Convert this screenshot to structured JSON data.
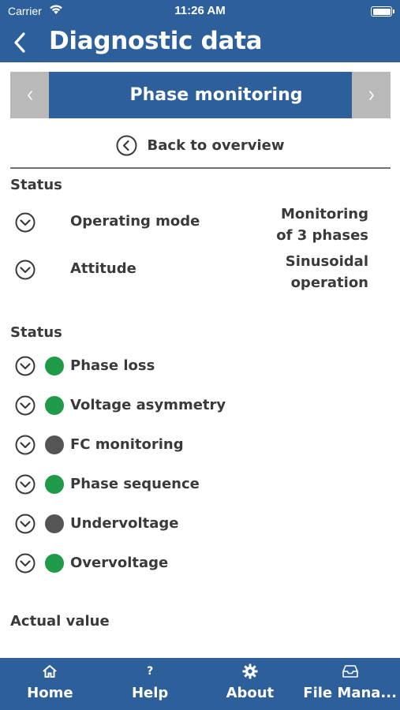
{
  "status_bar": {
    "carrier": "Carrier",
    "time": "11:26 AM"
  },
  "nav": {
    "title": "Diagnostic data"
  },
  "pager": {
    "title": "Phase monitoring"
  },
  "back_link": {
    "label": "Back to overview"
  },
  "section1": {
    "title": "Status",
    "rows": [
      {
        "label": "Operating mode",
        "value_line1": "Monitoring",
        "value_line2": "of 3 phases"
      },
      {
        "label": "Attitude",
        "value_line1": "Sinusoidal",
        "value_line2": "operation"
      }
    ]
  },
  "section2": {
    "title": "Status",
    "rows": [
      {
        "label": "Phase loss",
        "state": "green"
      },
      {
        "label": "Voltage asymmetry",
        "state": "green"
      },
      {
        "label": "FC monitoring",
        "state": "gray"
      },
      {
        "label": "Phase sequence",
        "state": "green"
      },
      {
        "label": "Undervoltage",
        "state": "gray"
      },
      {
        "label": "Overvoltage",
        "state": "green"
      }
    ]
  },
  "section3": {
    "title": "Actual value"
  },
  "tabs": [
    {
      "label": "Home",
      "icon": "home-icon"
    },
    {
      "label": "Help",
      "icon": "help-icon"
    },
    {
      "label": "About",
      "icon": "gear-icon"
    },
    {
      "label": "File Mana...",
      "icon": "inbox-icon"
    }
  ],
  "colors": {
    "primary": "#2d5f9a",
    "led_green": "#1e9a48",
    "led_gray": "#555555",
    "pager_arrow": "#b9b9b9"
  }
}
